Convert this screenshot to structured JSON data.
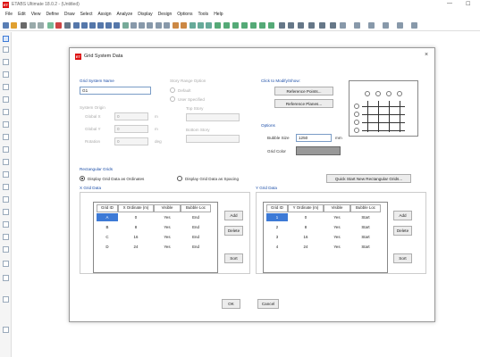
{
  "app": {
    "title": "ETABS Ultimate 18.0.2 - (Untitled)",
    "icon_label": "ET"
  },
  "window_controls": {
    "minimize": "—",
    "maximize": "☐"
  },
  "menu": [
    "File",
    "Edit",
    "View",
    "Define",
    "Draw",
    "Select",
    "Assign",
    "Analyze",
    "Display",
    "Design",
    "Options",
    "Tools",
    "Help"
  ],
  "dialog": {
    "title": "Grid System Data",
    "icon_label": "ET",
    "close": "×",
    "grid_system_name": {
      "label": "Grid System Name",
      "value": "G1"
    },
    "story_range": {
      "label": "Story Range Option",
      "default": "Default",
      "user_specified": "User Specified",
      "top_story": "Top Story",
      "bottom_story": "Bottom Story"
    },
    "system_origin": {
      "label": "System Origin",
      "global_x": {
        "label": "Global X",
        "value": "0",
        "unit": "m"
      },
      "global_y": {
        "label": "Global Y",
        "value": "0",
        "unit": "m"
      },
      "rotation": {
        "label": "Rotation",
        "value": "0",
        "unit": "deg"
      }
    },
    "click_modify": {
      "label": "Click to Modify/Show:",
      "ref_points": "Reference Points...",
      "ref_planes": "Reference Planes..."
    },
    "options": {
      "label": "Options",
      "bubble_size": {
        "label": "Bubble Size",
        "value": "1250",
        "unit": "mm"
      },
      "grid_color": {
        "label": "Grid Color",
        "value": "#999999"
      }
    },
    "rect_grids": {
      "label": "Rectangular Grids",
      "opt_ordinates": "Display Grid Data as Ordinates",
      "opt_spacing": "Display Grid Data as Spacing",
      "quick_start": "Quick Start New Rectangular Grids..."
    },
    "x_grid": {
      "label": "X Grid Data",
      "headers": [
        "Grid ID",
        "X Ordinate (m)",
        "Visible",
        "Bubble Loc"
      ],
      "rows": [
        [
          "A",
          "0",
          "Yes",
          "End"
        ],
        [
          "B",
          "8",
          "Yes",
          "End"
        ],
        [
          "C",
          "16",
          "Yes",
          "End"
        ],
        [
          "D",
          "24",
          "Yes",
          "End"
        ]
      ],
      "add": "Add",
      "delete": "Delete",
      "sort": "Sort"
    },
    "y_grid": {
      "label": "Y Grid Data",
      "headers": [
        "Grid ID",
        "Y Ordinate (m)",
        "Visible",
        "Bubble Loc"
      ],
      "rows": [
        [
          "1",
          "0",
          "Yes",
          "Start"
        ],
        [
          "2",
          "8",
          "Yes",
          "Start"
        ],
        [
          "3",
          "16",
          "Yes",
          "Start"
        ],
        [
          "4",
          "24",
          "Yes",
          "Start"
        ]
      ],
      "add": "Add",
      "delete": "Delete",
      "sort": "Sort"
    },
    "ok": "OK",
    "cancel": "Cancel"
  }
}
